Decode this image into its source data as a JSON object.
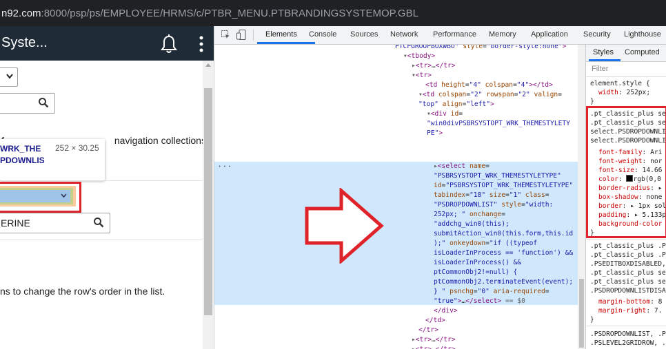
{
  "browser": {
    "url_host_partial": "n92.com",
    "url_rest": ":8000/psp/ps/EMPLOYEE/HRMS/c/PTBR_MENU.PTBRANDINGSYSTEMOP.GBL"
  },
  "page": {
    "title": "Syste...",
    "description_1": "f                                 navigation collections",
    "description_1_visible": "navigation collections",
    "tooltip": {
      "name_line1": "WRK_THE",
      "name_line2": "PDOWNLIS",
      "dimensions": "252 × 30.25"
    },
    "search_value": "ERINE",
    "description_2": "ns to change the row's order in the list."
  },
  "devtools": {
    "tabs": [
      "Elements",
      "Console",
      "Sources",
      "Network",
      "Performance",
      "Memory",
      "Application",
      "Security",
      "Lighthouse"
    ],
    "active_tab": "Elements",
    "selected_suffix": "== $0",
    "styles_tabs": [
      "Styles",
      "Computed"
    ],
    "filter_placeholder": "Filter",
    "element_style": {
      "selector": "element.style {",
      "prop": "width",
      "value": "252px;"
    },
    "rule_selectors": [
      ".pt_classic_plus se",
      ".pt_classic_plus se",
      "select.PSDROPDOWNLI",
      "select.PSDROPDOWNLI"
    ],
    "rule_props": [
      {
        "name": "font-family",
        "value": "Ari"
      },
      {
        "name": "font-weight",
        "value": "nor"
      },
      {
        "name": "font-size",
        "value": "14.66"
      },
      {
        "name": "color",
        "value": "rgb(0,0"
      },
      {
        "name": "border-radius",
        "value": "▸"
      },
      {
        "name": "box-shadow",
        "value": "none"
      },
      {
        "name": "border",
        "value": "▸ 1px sol"
      },
      {
        "name": "padding",
        "value": "▸ 5.133p"
      },
      {
        "name": "background-color",
        "value": ""
      }
    ],
    "rule2_selectors": [
      ".pt_classic_plus .P",
      ".pt_classic_plus .P",
      ".PSEDITBOXDISABLED,",
      ".pt_classic_plus se",
      ".pt_classic_plus se",
      ".PSDROPDOWNLISTDISA"
    ],
    "rule2_props": [
      {
        "name": "margin-bottom",
        "value": "8"
      },
      {
        "name": "margin-right",
        "value": "7."
      }
    ],
    "rule3_selectors": [
      ".PSDROPDOWNLIST, .P",
      ".PSLEVEL2GRIDROW, ."
    ]
  },
  "colors": {
    "highlight_red": "#e0232b",
    "header_dark": "#1f2c38",
    "selection_blue": "#cfe8fc",
    "tag_purple": "#881280",
    "attr_brown": "#994500",
    "value_blue": "#1a1aa6"
  }
}
